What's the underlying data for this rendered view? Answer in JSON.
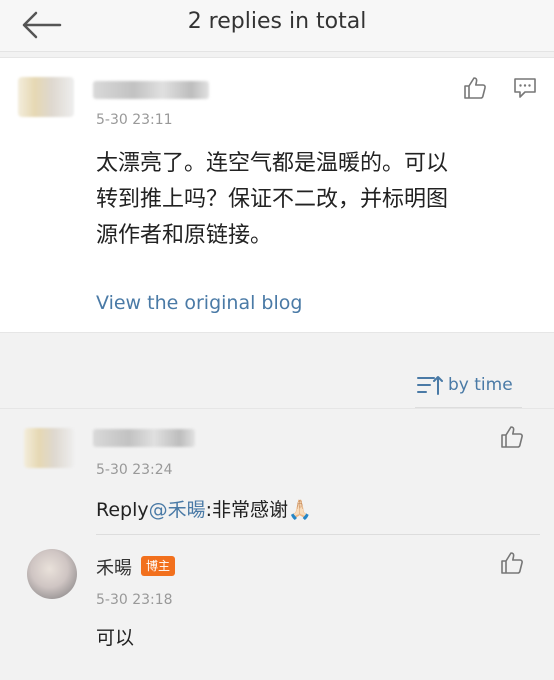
{
  "header": {
    "title": "2 replies in total",
    "back_icon": "arrow-left-icon"
  },
  "comment": {
    "time": "5-30 23:11",
    "text_line1": "太漂亮了。连空气都是温暖的。可以",
    "text_line2": "转到推上吗？保证不二改，并标明图",
    "text_line3": "源作者和原链接。",
    "view_link": "View the original blog",
    "like_icon": "thumbs-up-icon",
    "reply_icon": "comment-icon"
  },
  "sort": {
    "label": "by time",
    "icon": "sort-icon"
  },
  "replies": [
    {
      "time": "5-30 23:24",
      "prefix": "Reply",
      "mention": "@禾暘",
      "text": ":非常感谢🙏🏻",
      "like_icon": "thumbs-up-icon"
    },
    {
      "name": "禾暘",
      "badge": "博主",
      "time": "5-30 23:18",
      "text": "可以",
      "like_icon": "thumbs-up-icon"
    }
  ],
  "colors": {
    "link": "#4a7aa6",
    "badge": "#f2701d",
    "background": "#f2f2f2"
  }
}
